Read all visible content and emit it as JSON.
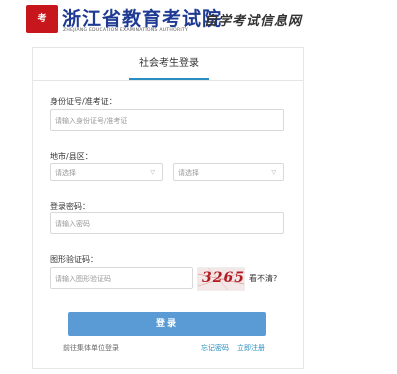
{
  "header": {
    "logo_glyph": "考",
    "title": "浙江省教育考试院",
    "subtitle": "ZHEJIANG EDUCATION EXAMINATIONS AUTHORITY",
    "system_name": "自学考试信息网"
  },
  "login": {
    "tab_label": "社会考生登录",
    "id_label": "身份证号/准考证：",
    "id_placeholder": "请输入身份证号/准考证",
    "region_label": "地市/县区：",
    "city_select": "请选择",
    "county_select": "请选择",
    "password_label": "登录密码：",
    "password_placeholder": "请输入密码",
    "captcha_label": "图形验证码：",
    "captcha_placeholder": "请输入图形验证码",
    "captcha_code": "3265",
    "refresh_text": "看不清?",
    "submit_label": "登录",
    "group_login_link": "前往集体单位登录",
    "forgot_password_link": "忘记密码",
    "register_link": "立即注册"
  },
  "colors": {
    "accent": "#2a8ec1",
    "button": "#5b9bd5",
    "brand_red": "#c8161d",
    "title_blue": "#1f3a93"
  }
}
